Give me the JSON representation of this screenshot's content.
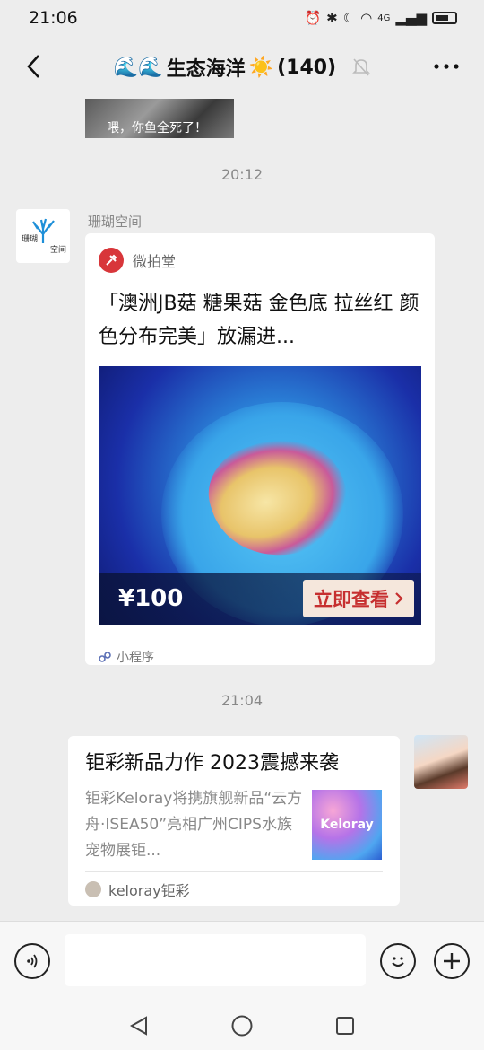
{
  "status_bar": {
    "time": "21:06",
    "network": "4G"
  },
  "header": {
    "title_prefix_emoji": "🌊🌊",
    "title": "生态海洋",
    "title_sun_emoji": "☀️",
    "member_count": "(140)"
  },
  "chat": {
    "partial_image_caption": "喂，你鱼全死了！",
    "timestamp_1": "20:12",
    "sender_name": "珊瑚空间",
    "avatar_left_label_1": "珊瑚",
    "avatar_left_label_2": "空间",
    "mini_program": {
      "source": "微拍堂",
      "title": "「澳洲JB菇 糖果菇 金色底 拉丝红 颜色分布完美」放漏进...",
      "price": "¥100",
      "view_button": "立即查看",
      "footer_label": "小程序"
    },
    "timestamp_2": "21:04",
    "article": {
      "title": "钜彩新品力作 2023震撼来袭",
      "description": "钜彩Keloray将携旗舰新品“云方舟·ISEA50”亮相广州CIPS水族宠物展钜...",
      "thumb_text": "Keloray",
      "source": "keloray钜彩"
    }
  },
  "input": {
    "placeholder": ""
  },
  "colors": {
    "background": "#ededed",
    "card": "#ffffff",
    "accent_red": "#c62f2f"
  }
}
